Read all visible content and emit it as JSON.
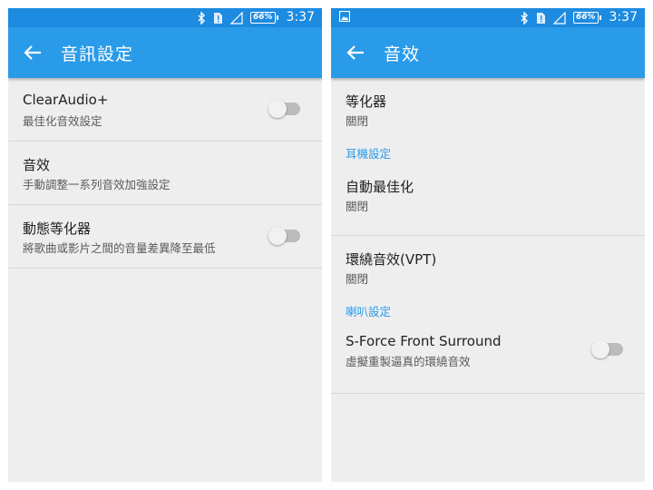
{
  "status_bar": {
    "battery": "66%",
    "time": "3:37",
    "icons": [
      "bluetooth-icon",
      "sim-alert-icon",
      "signal-icon",
      "battery-icon",
      "image-notification-icon"
    ]
  },
  "colors": {
    "status_bar": "#1c8be0",
    "app_bar": "#2a9be8",
    "accent": "#2a9be8",
    "background": "#eeeeee",
    "toggle_off": "#bcbcbc"
  },
  "left_screen": {
    "title": "音訊設定",
    "items": [
      {
        "title": "ClearAudio+",
        "subtitle": "最佳化音效設定",
        "toggle": false
      },
      {
        "title": "音效",
        "subtitle": "手動調整一系列音效加強設定"
      },
      {
        "title": "動態等化器",
        "subtitle": "將歌曲或影片之間的音量差異降至最低",
        "toggle": false
      }
    ]
  },
  "right_screen": {
    "title": "音效",
    "equalizer": {
      "title": "等化器",
      "subtitle": "關閉"
    },
    "headphone_section": "耳機設定",
    "auto_optimize": {
      "title": "自動最佳化",
      "subtitle": "關閉"
    },
    "vpt": {
      "title": "環繞音效(VPT)",
      "subtitle": "關閉"
    },
    "speaker_section": "喇叭設定",
    "sforce": {
      "title": "S-Force Front Surround",
      "subtitle": "虛擬重製逼真的環繞音效",
      "toggle": false
    }
  }
}
